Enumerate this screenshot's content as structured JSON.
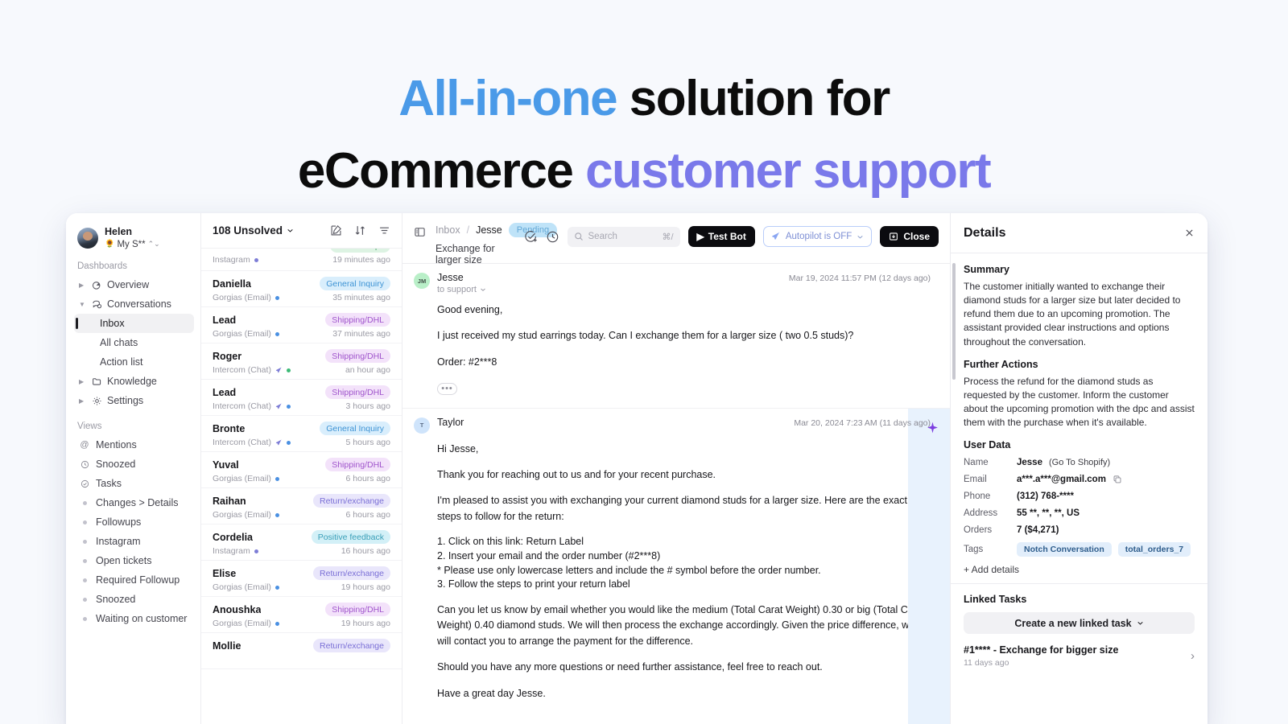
{
  "headline": {
    "line1_a": "All-in-one",
    "line1_b": " solution for",
    "line2_a": "eCommerce ",
    "line2_b": "customer support",
    "color_blue": "#4a9ae8",
    "color_violet": "#7a79ea"
  },
  "sidebar": {
    "user": {
      "name": "Helen",
      "workspace": "My S**",
      "emoji": "🌻"
    },
    "dashboards_label": "Dashboards",
    "dashboards": [
      {
        "label": "Overview",
        "icon": "pie-chart-icon",
        "expandable": true,
        "expanded": false
      },
      {
        "label": "Conversations",
        "icon": "chat-bubbles-icon",
        "expandable": true,
        "expanded": true
      }
    ],
    "conversation_children": [
      {
        "label": "Inbox",
        "active": true
      },
      {
        "label": "All chats",
        "active": false
      },
      {
        "label": "Action list",
        "active": false
      }
    ],
    "dashboards_tail": [
      {
        "label": "Knowledge",
        "icon": "folder-icon",
        "expandable": true
      },
      {
        "label": "Settings",
        "icon": "gear-icon",
        "expandable": true
      }
    ],
    "views_label": "Views",
    "views": [
      {
        "label": "Mentions",
        "icon": "at-icon"
      },
      {
        "label": "Snoozed",
        "icon": "clock-icon"
      },
      {
        "label": "Tasks",
        "icon": "check-circle-icon"
      },
      {
        "label": "Changes > Details",
        "icon": "dot-icon"
      },
      {
        "label": "Followups",
        "icon": "dot-icon"
      },
      {
        "label": "Instagram",
        "icon": "dot-icon"
      },
      {
        "label": "Open tickets",
        "icon": "dot-icon"
      },
      {
        "label": "Required Followup",
        "icon": "dot-icon"
      },
      {
        "label": "Snoozed",
        "icon": "dot-icon"
      },
      {
        "label": "Waiting on customer",
        "icon": "dot-icon"
      }
    ]
  },
  "conversation_list": {
    "filter_label": "108 Unsolved",
    "actions": [
      "compose-icon",
      "sort-icon",
      "filter-icon"
    ],
    "rows": [
      {
        "name": "",
        "source": "Instagram",
        "time": "19 minutes ago",
        "badge": "Partnerships",
        "badge_class": "bg-partner",
        "dot": "#7d7dd6",
        "plane": false,
        "clipped": true
      },
      {
        "name": "Daniella",
        "source": "Gorgias (Email)",
        "time": "35 minutes ago",
        "badge": "General Inquiry",
        "badge_class": "bg-general",
        "dot": "#4a90e2",
        "plane": false
      },
      {
        "name": "Lead",
        "source": "Gorgias (Email)",
        "time": "37 minutes ago",
        "badge": "Shipping/DHL",
        "badge_class": "bg-ship",
        "dot": "#4a90e2",
        "plane": false
      },
      {
        "name": "Roger",
        "source": "Intercom (Chat)",
        "time": "an hour ago",
        "badge": "Shipping/DHL",
        "badge_class": "bg-ship",
        "dot": "#3dba77",
        "plane": true
      },
      {
        "name": "Lead",
        "source": "Intercom (Chat)",
        "time": "3 hours ago",
        "badge": "Shipping/DHL",
        "badge_class": "bg-ship",
        "dot": "#4a90e2",
        "plane": true
      },
      {
        "name": "Bronte",
        "source": "Intercom (Chat)",
        "time": "5 hours ago",
        "badge": "General Inquiry",
        "badge_class": "bg-general",
        "dot": "#4a90e2",
        "plane": true
      },
      {
        "name": "Yuval",
        "source": "Gorgias (Email)",
        "time": "6 hours ago",
        "badge": "Shipping/DHL",
        "badge_class": "bg-ship",
        "dot": "#4a90e2",
        "plane": false
      },
      {
        "name": "Raihan",
        "source": "Gorgias (Email)",
        "time": "6 hours ago",
        "badge": "Return/exchange",
        "badge_class": "bg-return",
        "dot": "#4a90e2",
        "plane": false
      },
      {
        "name": "Cordelia",
        "source": "Instagram",
        "time": "16 hours ago",
        "badge": "Positive feedback",
        "badge_class": "bg-positive",
        "dot": "#7d7dd6",
        "plane": false
      },
      {
        "name": "Elise",
        "source": "Gorgias (Email)",
        "time": "19 hours ago",
        "badge": "Return/exchange",
        "badge_class": "bg-return",
        "dot": "#4a90e2",
        "plane": false
      },
      {
        "name": "Anoushka",
        "source": "Gorgias (Email)",
        "time": "19 hours ago",
        "badge": "Shipping/DHL",
        "badge_class": "bg-ship",
        "dot": "#4a90e2",
        "plane": false
      },
      {
        "name": "Mollie",
        "source": "",
        "time": "",
        "badge": "Return/exchange",
        "badge_class": "bg-return",
        "dot": "",
        "plane": false
      }
    ]
  },
  "header": {
    "breadcrumb_root": "Inbox",
    "breadcrumb_sep": "/",
    "breadcrumb_current": "Jesse",
    "status_pill": "Pending",
    "subject": "Exchange for larger size",
    "search_placeholder": "Search",
    "search_shortcut": "⌘/",
    "test_bot_label": "Test Bot",
    "autopilot_label": "Autopilot is OFF",
    "close_label": "Close"
  },
  "thread": {
    "messages": [
      {
        "author": "Jesse",
        "initials": "JM",
        "to": "to support",
        "timestamp": "Mar 19, 2024 11:57 PM (12 days ago)",
        "paragraphs": [
          "Good evening,",
          "I just received my stud earrings today. Can I exchange them for a larger size ( two 0.5 studs)?",
          "Order: #2***8"
        ],
        "has_more_chip": true,
        "more_chip": "•••"
      },
      {
        "author": "Taylor",
        "initials": "T",
        "to": "",
        "timestamp": "Mar 20, 2024 7:23 AM (11 days ago)",
        "paragraphs": [
          "Hi Jesse,",
          "Thank you for reaching out to us and for your recent purchase.",
          "I'm pleased to assist you with exchanging your current diamond studs for a larger size. Here are the exact steps to follow for the return:",
          "1. Click on this link: Return Label\n2. Insert your email and the order number (#2***8)\n* Please use only lowercase letters and include the # symbol before the order number.\n3. Follow the steps to print your return label",
          "Can you let us know by email whether you would like the medium (Total Carat Weight) 0.30 or big (Total Carat Weight) 0.40 diamond studs. We will then process the exchange accordingly. Given the price difference, we will contact you to arrange the payment for the difference.",
          "Should you have any more questions or need further assistance, feel free to reach out.",
          "Have a great day Jesse."
        ],
        "has_more_chip": false,
        "has_sparkle": true
      }
    ]
  },
  "details": {
    "title": "Details",
    "summary_heading": "Summary",
    "summary_text": "The customer initially wanted to exchange their diamond studs for a larger size but later decided to refund them due to an upcoming promotion. The assistant provided clear instructions and options throughout the conversation.",
    "actions_heading": "Further Actions",
    "actions_text": "Process the refund for the diamond studs as requested by the customer. Inform the customer about the upcoming promotion with the dpc and assist them with the purchase when it's available.",
    "user_data_heading": "User Data",
    "fields": [
      {
        "key": "Name",
        "value": "Jesse",
        "note": "(Go To Shopify)"
      },
      {
        "key": "Email",
        "value": "a***.a***@gmail.com",
        "copy": true
      },
      {
        "key": "Phone",
        "value": "(312) 768-****"
      },
      {
        "key": "Address",
        "value": "55 **, **, **, US"
      },
      {
        "key": "Orders",
        "value": "7 ($4,271)"
      }
    ],
    "tags_key": "Tags",
    "tags": [
      "Notch Conversation",
      "total_orders_7"
    ],
    "add_details_label": "+ Add details",
    "linked_tasks_heading": "Linked Tasks",
    "create_task_label": "Create a new linked task",
    "tasks": [
      {
        "title": "#1**** - Exchange for bigger size",
        "time": "11 days ago"
      }
    ]
  }
}
